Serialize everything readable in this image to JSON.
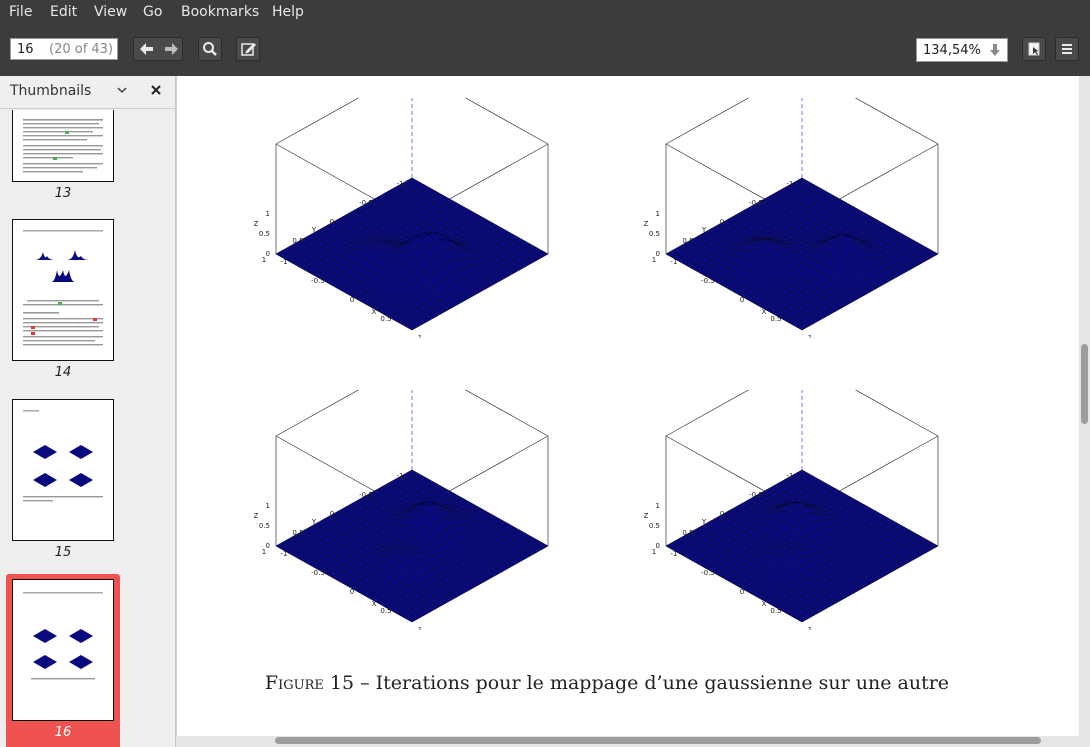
{
  "menu": {
    "items": [
      {
        "label": "File"
      },
      {
        "label": "Edit"
      },
      {
        "label": "View"
      },
      {
        "label": "Go"
      },
      {
        "label": "Bookmarks"
      },
      {
        "label": "Help"
      }
    ]
  },
  "toolbar": {
    "page_current": "16",
    "page_total": "(20 of 43)",
    "zoom": "134,54%",
    "icons": [
      "arrow-left-icon",
      "arrow-right-icon",
      "search-icon",
      "edit-annotate-icon",
      "presentation-icon",
      "hamburger-menu-icon"
    ]
  },
  "sidebar": {
    "title": "Thumbnails",
    "thumbnails": [
      {
        "number": "13"
      },
      {
        "number": "14"
      },
      {
        "number": "15"
      },
      {
        "number": "16",
        "selected": true
      }
    ]
  },
  "document": {
    "caption_label": "Figure 15",
    "caption_text": " – Iterations pour le mappage d’une gaussienne sur une autre",
    "plot_labels": {
      "z_axis": "Z",
      "y_axis": "Y",
      "x_axis": "X",
      "ticks_z": [
        "1",
        "0.5",
        "0"
      ],
      "ticks_y": [
        "-1",
        "-0.5",
        "0",
        "0.5",
        "1"
      ],
      "ticks_x": [
        "-1",
        "-0.5",
        "0",
        "0.5",
        "1"
      ]
    }
  },
  "colors": {
    "surface": "#0a0a80",
    "selection": "#ef5350",
    "toolbar_bg": "#3c3c3c"
  }
}
